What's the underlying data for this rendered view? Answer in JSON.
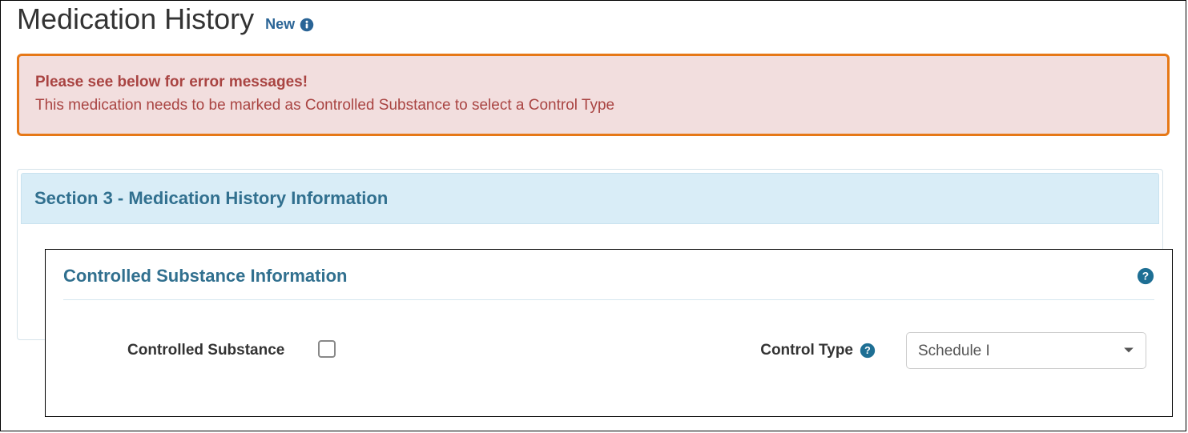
{
  "page": {
    "title": "Medication History",
    "badge": "New"
  },
  "alert": {
    "title": "Please see below for error messages!",
    "message": "This medication needs to be marked as Controlled Substance to select a Control Type"
  },
  "section": {
    "title": "Section 3 - Medication History Information"
  },
  "subsection": {
    "title": "Controlled Substance Information"
  },
  "fields": {
    "controlled_substance": {
      "label": "Controlled Substance",
      "checked": false
    },
    "control_type": {
      "label": "Control Type",
      "selected": "Schedule I",
      "options": [
        "Schedule I"
      ]
    }
  },
  "colors": {
    "header_teal": "#31708f",
    "alert_border": "#e67817",
    "alert_bg": "#f2dede",
    "alert_text": "#a94442",
    "link_blue": "#2a6496"
  }
}
